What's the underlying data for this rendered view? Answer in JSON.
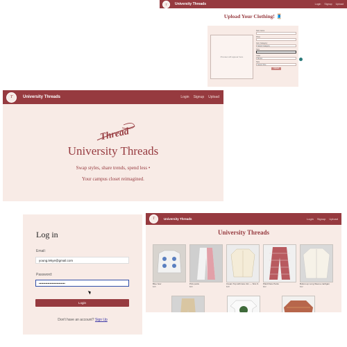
{
  "brand": "University Threads",
  "nav_links": [
    "Login",
    "Signup",
    "Upload"
  ],
  "upload": {
    "title": "Upload Your Clothing! 🧵",
    "photo_placeholder": "Preview will appear here",
    "fields": [
      {
        "label": "Item name",
        "value": ""
      },
      {
        "label": "Price",
        "value": ""
      },
      {
        "label": "Item Category",
        "value": "Select Category"
      },
      {
        "label": "Size",
        "value": ""
      },
      {
        "label": "Color",
        "value": "Brown"
      },
      {
        "label": "Size",
        "value": "Select Size"
      }
    ],
    "submit": "Upload"
  },
  "home": {
    "logo_text": "Thread",
    "title": "University Threads",
    "subtitle": "Swap styles, share trends, spend less •",
    "tagline": "Your campus closet reimagined."
  },
  "login": {
    "title": "Log in",
    "email_label": "Email:",
    "email_value": "young.lekye@gmail.com",
    "password_label": "Password:",
    "password_value": "••••••••••••••••••••••••",
    "button": "Login",
    "footer_text": "Don't have an account?",
    "signup_link": "Sign Up"
  },
  "catalog": {
    "title": "University Threads",
    "items": [
      {
        "name": "Blue bow",
        "price": "$15"
      },
      {
        "name": "Pink pants",
        "price": "$20"
      },
      {
        "name": "Cream Top with lace trim — Size S",
        "price": "$18"
      },
      {
        "name": "Plaid Flare Pants",
        "price": "$22"
      },
      {
        "name": "Button-up Long Sleeve cardigan",
        "price": "$12"
      },
      {
        "name": "",
        "price": ""
      },
      {
        "name": "",
        "price": ""
      },
      {
        "name": "",
        "price": ""
      }
    ]
  }
}
